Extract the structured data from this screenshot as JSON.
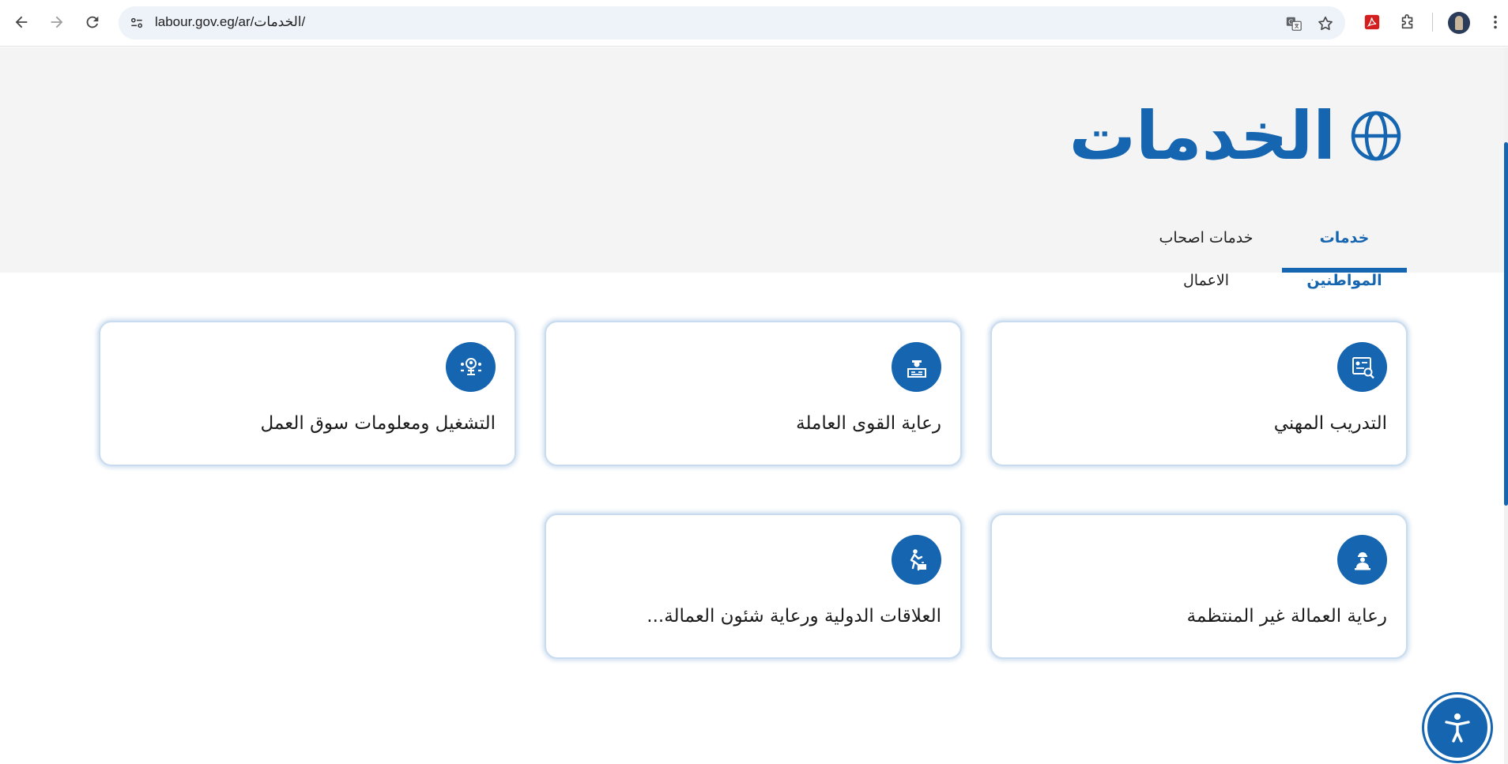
{
  "browser": {
    "url": "labour.gov.eg/ar/الخدمات/",
    "icons": [
      "back-arrow-icon",
      "forward-arrow-icon",
      "reload-icon",
      "site-info-icon",
      "translate-icon",
      "bookmark-star-icon",
      "pdf-extension-icon",
      "extensions-puzzle-icon",
      "profile-avatar",
      "more-menu-icon"
    ]
  },
  "header": {
    "title": "الخدمات",
    "title_icon": "globe-icon"
  },
  "tabs": [
    {
      "label": "خدمات المواطنين",
      "active": true
    },
    {
      "label": "خدمات اصحاب الاعمال",
      "active": false
    }
  ],
  "cards": [
    {
      "label": "التدريب المهني",
      "icon": "training-certificate-icon"
    },
    {
      "label": "رعاية القوى العاملة",
      "icon": "worker-care-icon"
    },
    {
      "label": "التشغيل ومعلومات سوق العمل",
      "icon": "employment-network-icon"
    },
    {
      "label": "رعاية العمالة غير المنتظمة",
      "icon": "irregular-workers-icon"
    },
    {
      "label": "العلاقات الدولية ورعاية شئون العمالة...",
      "icon": "international-relations-icon"
    }
  ],
  "accessibility": {
    "icon": "accessibility-icon"
  },
  "colors": {
    "brand_blue": "#1565b0",
    "hero_bg": "#f4f4f4",
    "omnibox_bg": "#eef2f9"
  }
}
